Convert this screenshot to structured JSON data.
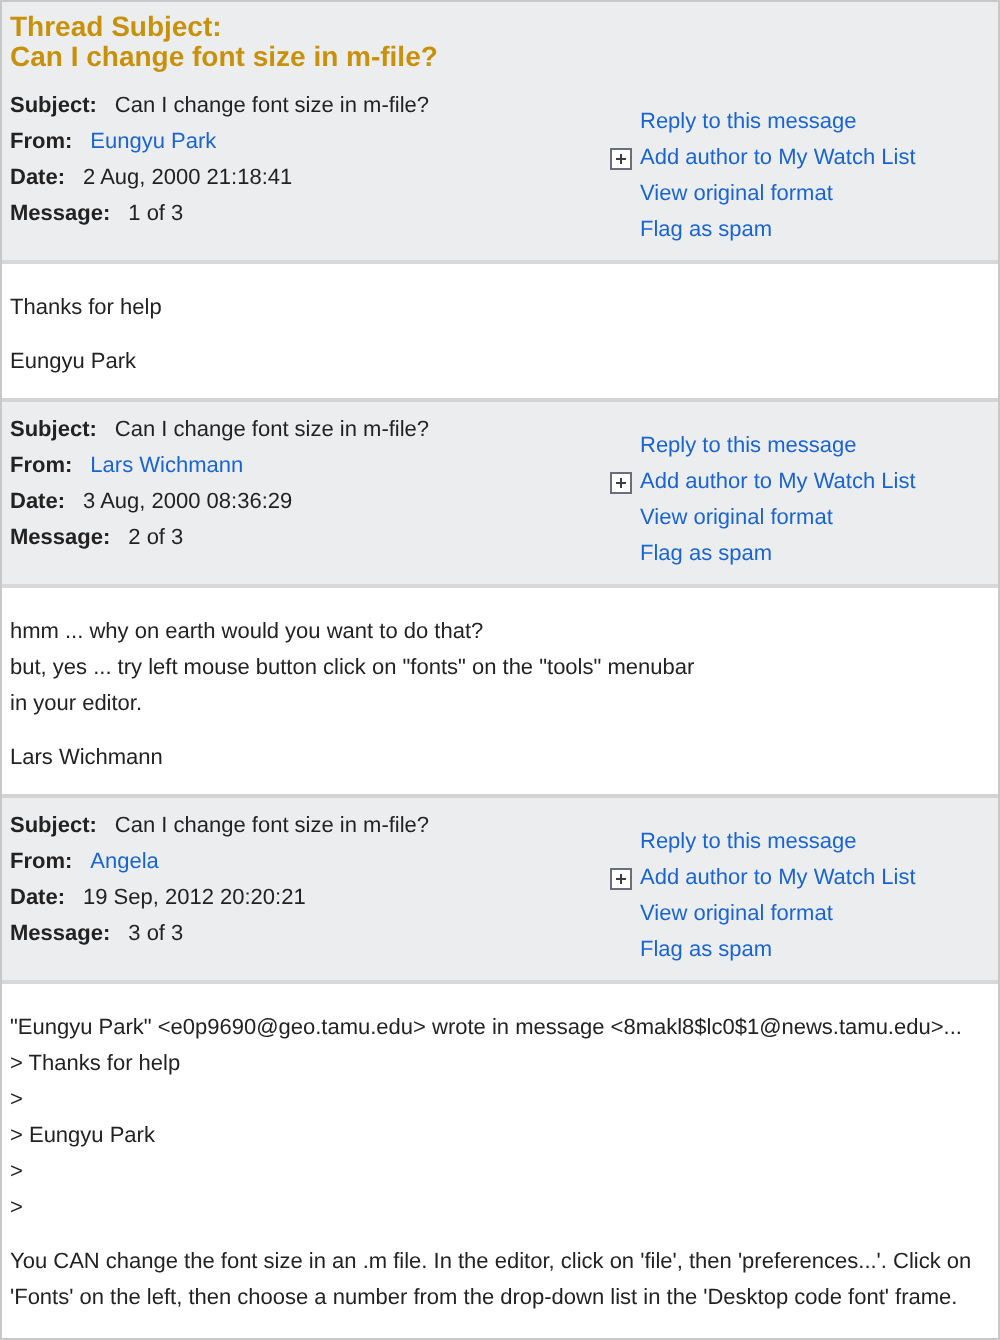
{
  "thread": {
    "label": "Thread Subject:",
    "subject": "Can I change font size in m-file?"
  },
  "messages": [
    {
      "fields": [
        {
          "label": "Subject:",
          "value": "Can I change font size in m-file?",
          "kind": "text"
        },
        {
          "label": "From:",
          "value": "Eungyu Park",
          "kind": "link"
        },
        {
          "label": "Date:",
          "value": "2 Aug, 2000 21:18:41",
          "kind": "text"
        },
        {
          "label": "Message:",
          "value": "1 of 3",
          "kind": "text"
        }
      ],
      "actions": [
        {
          "label": "Reply to this message",
          "kind": "link"
        },
        {
          "label": "Add author to My Watch List",
          "kind": "watch"
        },
        {
          "label": "View original format",
          "kind": "link"
        },
        {
          "label": "Flag as spam",
          "kind": "link"
        }
      ],
      "body": [
        [
          "Thanks for help"
        ],
        [
          "Eungyu Park"
        ]
      ]
    },
    {
      "fields": [
        {
          "label": "Subject:",
          "value": "Can I change font size in m-file?",
          "kind": "text"
        },
        {
          "label": "From:",
          "value": "Lars Wichmann",
          "kind": "link"
        },
        {
          "label": "Date:",
          "value": "3 Aug, 2000 08:36:29",
          "kind": "text"
        },
        {
          "label": "Message:",
          "value": "2 of 3",
          "kind": "text"
        }
      ],
      "actions": [
        {
          "label": "Reply to this message",
          "kind": "link"
        },
        {
          "label": "Add author to My Watch List",
          "kind": "watch"
        },
        {
          "label": "View original format",
          "kind": "link"
        },
        {
          "label": "Flag as spam",
          "kind": "link"
        }
      ],
      "body": [
        [
          "hmm ... why on earth would you want to do that?",
          "but, yes ... try left mouse button click on \"fonts\" on the \"tools\" menubar",
          "in your editor."
        ],
        [
          "Lars Wichmann"
        ]
      ]
    },
    {
      "fields": [
        {
          "label": "Subject:",
          "value": "Can I change font size in m-file?",
          "kind": "text"
        },
        {
          "label": "From:",
          "value": "Angela",
          "kind": "link"
        },
        {
          "label": "Date:",
          "value": "19 Sep, 2012 20:20:21",
          "kind": "text"
        },
        {
          "label": "Message:",
          "value": "3 of 3",
          "kind": "text"
        }
      ],
      "actions": [
        {
          "label": "Reply to this message",
          "kind": "link"
        },
        {
          "label": "Add author to My Watch List",
          "kind": "watch"
        },
        {
          "label": "View original format",
          "kind": "link"
        },
        {
          "label": "Flag as spam",
          "kind": "link"
        }
      ],
      "body": [
        [
          "\"Eungyu Park\" <e0p9690@geo.tamu.edu> wrote in message <8makl8$lc0$1@news.tamu.edu>...",
          "> Thanks for help",
          ">",
          "> Eungyu Park",
          ">",
          ">"
        ],
        [
          "You CAN change the font size in an .m file. In the editor, click on 'file', then 'preferences...'. Click on 'Fonts' on the left, then choose a number from the drop-down list in the 'Desktop code font' frame."
        ]
      ]
    }
  ]
}
